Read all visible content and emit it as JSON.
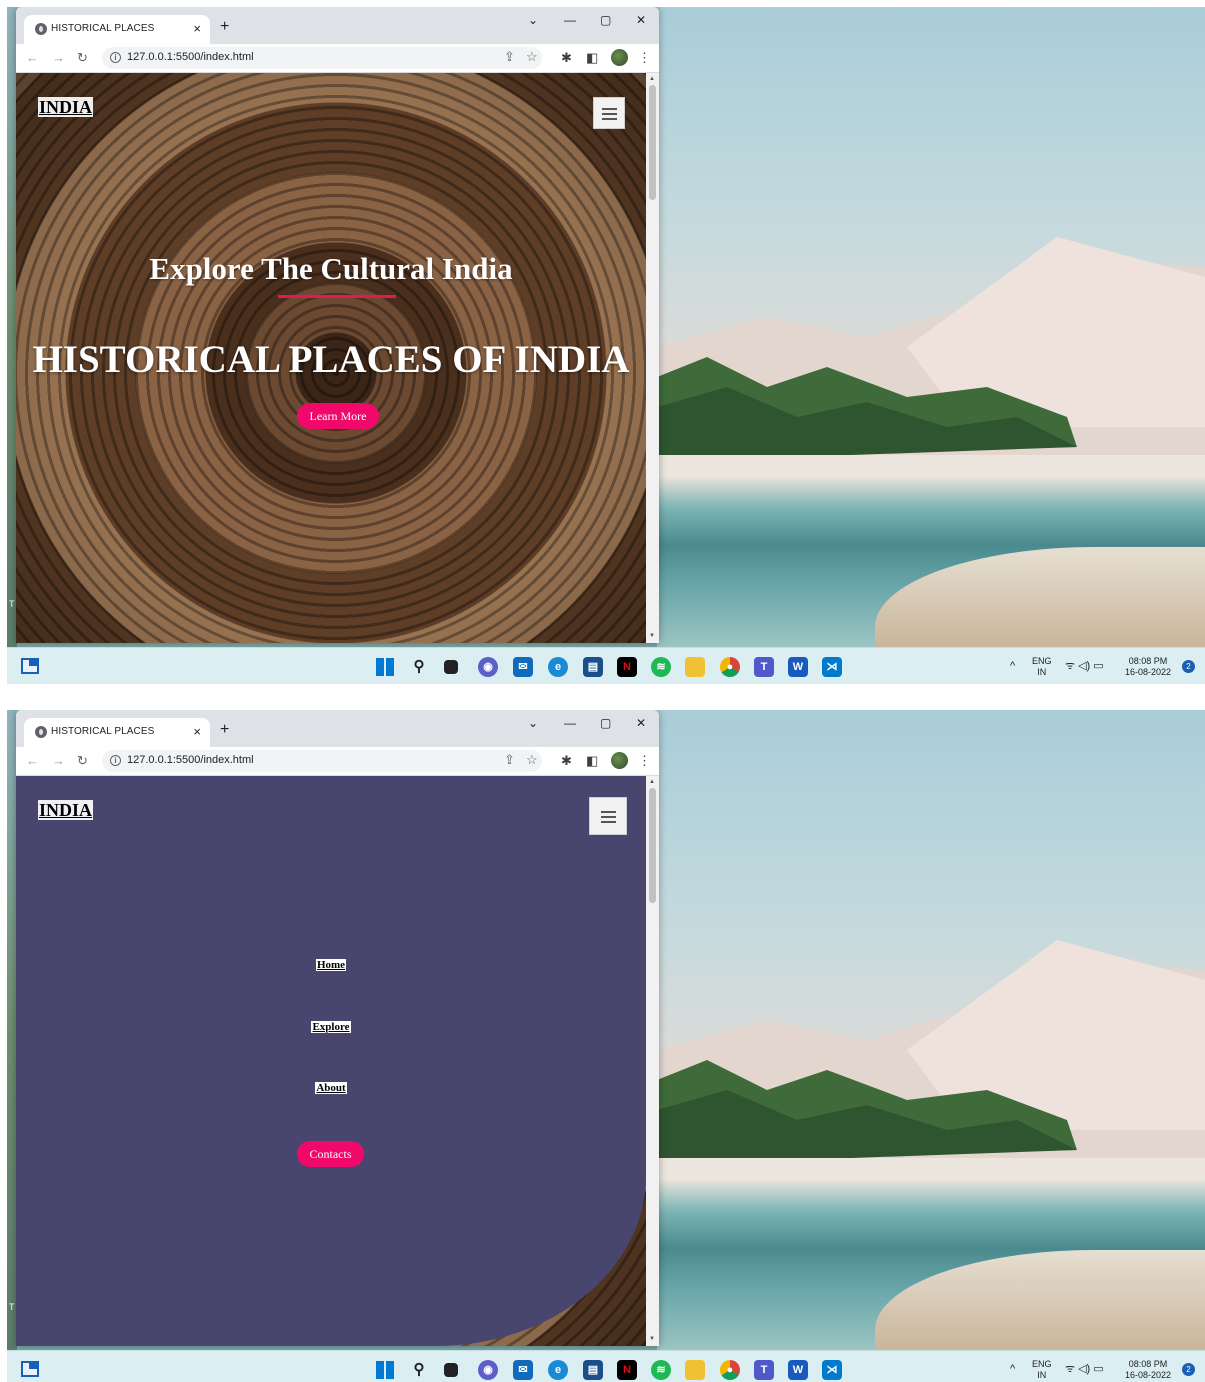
{
  "browser": {
    "tab_title": "HISTORICAL PLACES",
    "url": "127.0.0.1:5500/index.html"
  },
  "site": {
    "logo": "INDIA",
    "hero_subtitle": "Explore The Cultural India",
    "hero_title": "HISTORICAL PLACES OF INDIA",
    "cta_label": "Learn More",
    "nav": [
      {
        "label": "Home"
      },
      {
        "label": "Explore"
      },
      {
        "label": "About"
      }
    ],
    "contacts_label": "Contacts"
  },
  "taskbar": {
    "lang_top": "ENG",
    "lang_bottom": "IN",
    "time": "08:08 PM",
    "date": "16-08-2022",
    "notification_count": "2"
  },
  "desktop": {
    "edge_text": "T"
  },
  "colors": {
    "accent": "#f0096a",
    "menu_overlay": "#48466f",
    "hero_line": "#e8174f"
  },
  "icons": [
    "widgets-icon",
    "windows-start-icon",
    "search-icon",
    "task-view-icon",
    "chat-icon",
    "mail-icon",
    "edge-icon",
    "store-icon",
    "netflix-icon",
    "spotify-icon",
    "file-explorer-icon",
    "chrome-icon",
    "teams-icon",
    "word-icon",
    "vscode-icon"
  ]
}
